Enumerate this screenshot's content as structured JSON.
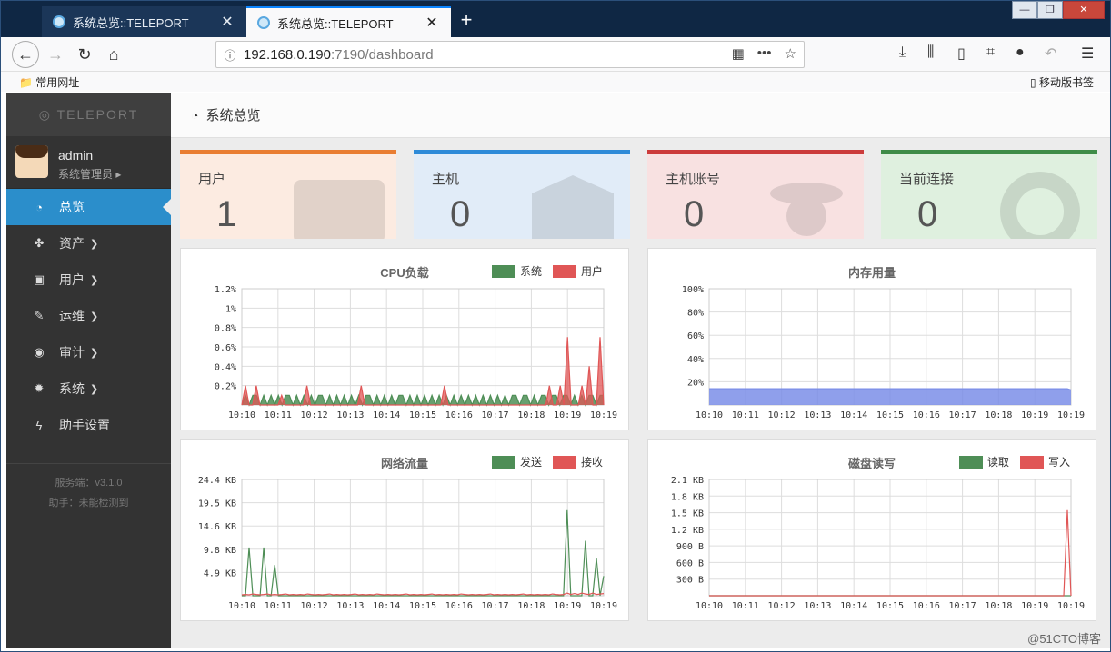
{
  "browser": {
    "tabs": [
      {
        "title": "系统总览::TELEPORT"
      },
      {
        "title": "系统总览::TELEPORT"
      }
    ],
    "url_host": "192.168.0.190",
    "url_rest": ":7190/dashboard",
    "bookmark_left": "常用网址",
    "bookmark_right": "移动版书签"
  },
  "sidebar": {
    "logo": "TELEPORT",
    "user_name": "admin",
    "user_role": "系统管理员",
    "items": [
      {
        "label": "总览",
        "icon": "dashboard-icon",
        "active": true
      },
      {
        "label": "资产",
        "icon": "assets-icon",
        "chevron": true
      },
      {
        "label": "用户",
        "icon": "user-card-icon",
        "chevron": true
      },
      {
        "label": "运维",
        "icon": "wrench-icon",
        "chevron": true
      },
      {
        "label": "审计",
        "icon": "eye-icon",
        "chevron": true
      },
      {
        "label": "系统",
        "icon": "gear-icon",
        "chevron": true
      },
      {
        "label": "助手设置",
        "icon": "bolt-icon",
        "chevron": false
      }
    ],
    "server_version": "服务端：v3.1.0",
    "assistant_status": "助手：未能检测到"
  },
  "page": {
    "title": "系统总览"
  },
  "cards": [
    {
      "label": "用户",
      "value": "1",
      "color": "#e97d31"
    },
    {
      "label": "主机",
      "value": "0",
      "color": "#2d8ad8"
    },
    {
      "label": "主机账号",
      "value": "0",
      "color": "#cc3b3b"
    },
    {
      "label": "当前连接",
      "value": "0",
      "color": "#3e8c47"
    }
  ],
  "chart_data": [
    {
      "type": "area",
      "title": "CPU负载",
      "legend": [
        "系统",
        "用户"
      ],
      "colors": [
        "#4e8e56",
        "#e05656"
      ],
      "y_ticks": [
        "1.2%",
        "1%",
        "0.8%",
        "0.6%",
        "0.4%",
        "0.2%"
      ],
      "ylim": [
        0,
        1.2
      ],
      "x_ticks": [
        "10:10",
        "10:11",
        "10:12",
        "10:13",
        "10:14",
        "10:15",
        "10:16",
        "10:17",
        "10:18",
        "10:19",
        "10:19"
      ],
      "series": [
        {
          "name": "系统",
          "values": [
            0,
            0.1,
            0,
            0.1,
            0.1,
            0,
            0.1,
            0,
            0.1,
            0,
            0.1,
            0,
            0.1,
            0.1,
            0,
            0.1,
            0,
            0.1,
            0,
            0.1,
            0,
            0.1,
            0.1,
            0,
            0.1,
            0,
            0.1,
            0,
            0.1,
            0,
            0.1,
            0,
            0.1,
            0,
            0.1,
            0.1,
            0,
            0.1,
            0,
            0.1,
            0,
            0.1,
            0,
            0.1,
            0.1,
            0,
            0.1,
            0,
            0.1,
            0,
            0.1,
            0,
            0.1,
            0,
            0.1,
            0,
            0.1,
            0,
            0.1,
            0,
            0.1,
            0,
            0.1,
            0,
            0.1,
            0,
            0.1,
            0,
            0.1,
            0,
            0.1,
            0,
            0.1,
            0,
            0.1,
            0.1,
            0,
            0.1,
            0.1,
            0,
            0.1,
            0,
            0.1,
            0.1,
            0,
            0.1,
            0.1,
            0,
            0.1,
            0.1,
            0,
            0.1,
            0,
            0.1,
            0,
            0.1,
            0.1,
            0,
            0.1,
            0.1
          ]
        },
        {
          "name": "用户",
          "values": [
            0,
            0.2,
            0,
            0,
            0.2,
            0,
            0,
            0,
            0,
            0,
            0,
            0.1,
            0,
            0,
            0,
            0,
            0,
            0,
            0.2,
            0,
            0,
            0,
            0,
            0,
            0,
            0,
            0,
            0,
            0,
            0,
            0,
            0,
            0,
            0.2,
            0,
            0,
            0,
            0,
            0,
            0,
            0,
            0,
            0,
            0,
            0,
            0,
            0,
            0,
            0,
            0,
            0,
            0,
            0,
            0,
            0,
            0,
            0.2,
            0,
            0,
            0,
            0,
            0,
            0,
            0,
            0,
            0,
            0,
            0,
            0,
            0,
            0,
            0,
            0,
            0,
            0,
            0,
            0,
            0,
            0,
            0,
            0,
            0,
            0,
            0,
            0,
            0.2,
            0,
            0,
            0.2,
            0,
            0.7,
            0,
            0,
            0,
            0.2,
            0,
            0.4,
            0,
            0,
            0.7,
            0
          ]
        }
      ]
    },
    {
      "type": "area",
      "title": "内存用量",
      "legend": [],
      "colors": [
        "#7b8ee8"
      ],
      "y_ticks": [
        "100%",
        "80%",
        "60%",
        "40%",
        "20%"
      ],
      "ylim": [
        0,
        100
      ],
      "x_ticks": [
        "10:10",
        "10:11",
        "10:12",
        "10:13",
        "10:14",
        "10:15",
        "10:16",
        "10:17",
        "10:18",
        "10:19",
        "10:19"
      ],
      "series": [
        {
          "name": "",
          "values": [
            14,
            14,
            14,
            14,
            14,
            14,
            14,
            14,
            14,
            14,
            14,
            14,
            14,
            14,
            14,
            14,
            14,
            14,
            14,
            14,
            14,
            14,
            14,
            14,
            14,
            14,
            14,
            14,
            14,
            14,
            14,
            14,
            14,
            14,
            14,
            14,
            14,
            14,
            14,
            14,
            14,
            14,
            14,
            14,
            14,
            14,
            14,
            14,
            14,
            14,
            14,
            14,
            14,
            14,
            14,
            14,
            14,
            14,
            14,
            14,
            14,
            14,
            14,
            14,
            14,
            14,
            14,
            14,
            14,
            14,
            14,
            14,
            14,
            14,
            14,
            14,
            14,
            14,
            14,
            14,
            14,
            14,
            14,
            14,
            14,
            14,
            14,
            14,
            14,
            14,
            14,
            14,
            14,
            14,
            14,
            14,
            14,
            14,
            14,
            13
          ]
        }
      ]
    },
    {
      "type": "line",
      "title": "网络流量",
      "legend": [
        "发送",
        "接收"
      ],
      "colors": [
        "#4e8e56",
        "#e05656"
      ],
      "y_ticks": [
        "24.4 KB",
        "19.5 KB",
        "14.6 KB",
        "9.8 KB",
        "4.9 KB"
      ],
      "ylim": [
        0,
        26.5
      ],
      "x_ticks": [
        "10:10",
        "10:11",
        "10:12",
        "10:13",
        "10:14",
        "10:15",
        "10:16",
        "10:17",
        "10:18",
        "10:19",
        "10:19"
      ],
      "series": [
        {
          "name": "发送",
          "values": [
            0,
            0,
            11,
            0,
            0,
            0,
            11,
            0,
            0,
            7,
            0,
            0,
            0,
            0,
            0,
            0,
            0,
            0,
            0,
            0,
            0,
            0,
            0,
            0,
            0,
            0,
            0,
            0,
            0,
            0,
            0,
            0,
            0,
            0,
            0,
            0,
            0,
            0,
            0,
            0,
            0,
            0,
            0,
            0,
            0,
            0,
            0,
            0,
            0,
            0,
            0,
            0,
            0,
            0,
            0,
            0,
            0,
            0,
            0,
            0,
            0,
            0,
            0,
            0,
            0,
            0,
            0,
            0,
            0,
            0,
            0,
            0,
            0,
            0,
            0,
            0,
            0,
            0,
            0,
            0,
            0,
            0,
            0,
            0,
            0,
            0,
            0,
            0,
            0,
            19.5,
            0,
            0,
            0,
            0,
            12.5,
            0,
            0,
            8.5,
            0,
            4.5
          ]
        },
        {
          "name": "接收",
          "values": [
            0.2,
            0.3,
            0.2,
            0.4,
            0.3,
            0.2,
            0.3,
            0.4,
            0.2,
            0.3,
            0.2,
            0.3,
            0.4,
            0.2,
            0.3,
            0.2,
            0.3,
            0.2,
            0.4,
            0.3,
            0.2,
            0.3,
            0.2,
            0.3,
            0.4,
            0.2,
            0.3,
            0.2,
            0.3,
            0.2,
            0.3,
            0.4,
            0.2,
            0.3,
            0.2,
            0.3,
            0.2,
            0.4,
            0.3,
            0.2,
            0.3,
            0.2,
            0.3,
            0.2,
            0.3,
            0.4,
            0.2,
            0.3,
            0.2,
            0.3,
            0.2,
            0.3,
            0.4,
            0.2,
            0.3,
            0.2,
            0.3,
            0.2,
            0.3,
            0.2,
            0.4,
            0.3,
            0.2,
            0.3,
            0.2,
            0.3,
            0.2,
            0.3,
            0.4,
            0.2,
            0.3,
            0.2,
            0.3,
            0.2,
            0.3,
            0.2,
            0.3,
            0.4,
            0.2,
            0.3,
            0.2,
            0.3,
            0.2,
            0.3,
            0.2,
            0.4,
            0.3,
            0.2,
            0.3,
            0.6,
            0.3,
            0.5,
            0.3,
            0.6,
            0.4,
            0.3,
            0.6,
            0.3,
            0.4,
            0.5
          ]
        }
      ]
    },
    {
      "type": "line",
      "title": "磁盘读写",
      "legend": [
        "读取",
        "写入"
      ],
      "colors": [
        "#4e8e56",
        "#e05656"
      ],
      "y_ticks": [
        "2.1 KB",
        "1.8 KB",
        "1.5 KB",
        "1.2 KB",
        "900 B",
        "600 B",
        "300 B"
      ],
      "ylim": [
        0,
        2.27
      ],
      "x_ticks": [
        "10:10",
        "10:11",
        "10:12",
        "10:13",
        "10:14",
        "10:15",
        "10:16",
        "10:17",
        "10:18",
        "10:19",
        "10:19"
      ],
      "series": [
        {
          "name": "读取",
          "values": [
            0,
            0,
            0,
            0,
            0,
            0,
            0,
            0,
            0,
            0,
            0,
            0,
            0,
            0,
            0,
            0,
            0,
            0,
            0,
            0,
            0,
            0,
            0,
            0,
            0,
            0,
            0,
            0,
            0,
            0,
            0,
            0,
            0,
            0,
            0,
            0,
            0,
            0,
            0,
            0,
            0,
            0,
            0,
            0,
            0,
            0,
            0,
            0,
            0,
            0,
            0,
            0,
            0,
            0,
            0,
            0,
            0,
            0,
            0,
            0,
            0,
            0,
            0,
            0,
            0,
            0,
            0,
            0,
            0,
            0,
            0,
            0,
            0,
            0,
            0,
            0,
            0,
            0,
            0,
            0,
            0,
            0,
            0,
            0,
            0,
            0,
            0,
            0,
            0,
            0,
            0,
            0,
            0,
            0,
            0,
            0,
            0,
            0,
            0,
            0
          ]
        },
        {
          "name": "写入",
          "values": [
            0,
            0,
            0,
            0,
            0,
            0,
            0,
            0,
            0,
            0,
            0,
            0,
            0,
            0,
            0,
            0,
            0,
            0,
            0,
            0,
            0,
            0,
            0,
            0,
            0,
            0,
            0,
            0,
            0,
            0,
            0,
            0,
            0,
            0,
            0,
            0,
            0,
            0,
            0,
            0,
            0,
            0,
            0,
            0,
            0,
            0,
            0,
            0,
            0,
            0,
            0,
            0,
            0,
            0,
            0,
            0,
            0,
            0,
            0,
            0,
            0,
            0,
            0,
            0,
            0,
            0,
            0,
            0,
            0,
            0,
            0,
            0,
            0,
            0,
            0,
            0,
            0,
            0,
            0,
            0,
            0,
            0,
            0,
            0,
            0,
            0,
            0,
            0,
            0,
            0,
            0,
            0,
            0,
            0,
            0,
            0,
            0,
            0,
            1.67,
            0
          ]
        }
      ]
    }
  ],
  "watermark": "@51CTO博客"
}
